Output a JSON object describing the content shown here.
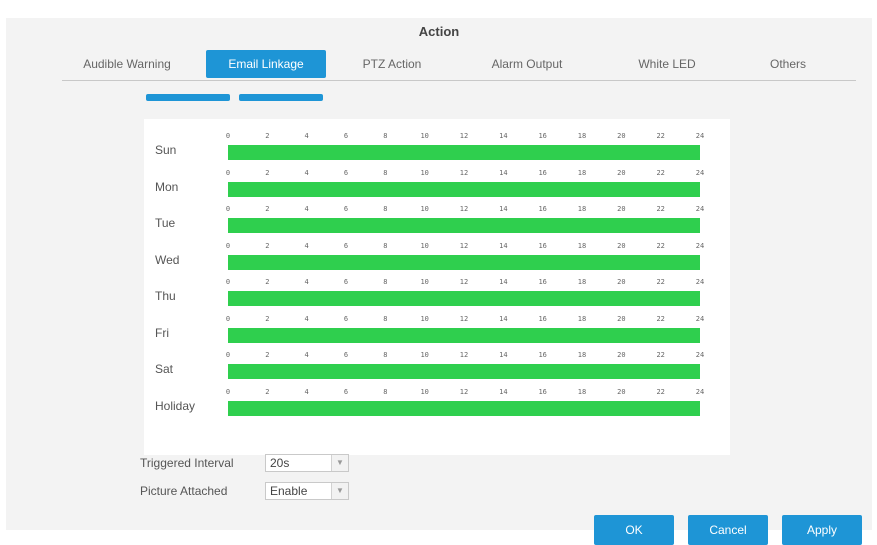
{
  "dialog": {
    "title": "Action"
  },
  "tabs": [
    {
      "label": "Audible Warning"
    },
    {
      "label": "Email Linkage"
    },
    {
      "label": "PTZ Action"
    },
    {
      "label": "Alarm Output"
    },
    {
      "label": "White LED"
    },
    {
      "label": "Others"
    }
  ],
  "schedule": {
    "ticks": [
      "0",
      "2",
      "4",
      "6",
      "8",
      "10",
      "12",
      "14",
      "16",
      "18",
      "20",
      "22",
      "24"
    ],
    "bar_color": "#2fcf4e",
    "days": [
      {
        "label": "Sun",
        "coverage": [
          0,
          24
        ]
      },
      {
        "label": "Mon",
        "coverage": [
          0,
          24
        ]
      },
      {
        "label": "Tue",
        "coverage": [
          0,
          24
        ]
      },
      {
        "label": "Wed",
        "coverage": [
          0,
          24
        ]
      },
      {
        "label": "Thu",
        "coverage": [
          0,
          24
        ]
      },
      {
        "label": "Fri",
        "coverage": [
          0,
          24
        ]
      },
      {
        "label": "Sat",
        "coverage": [
          0,
          24
        ]
      },
      {
        "label": "Holiday",
        "coverage": [
          0,
          24
        ]
      }
    ]
  },
  "settings": {
    "triggered_interval_label": "Triggered Interval",
    "triggered_interval_value": "20s",
    "picture_attached_label": "Picture Attached",
    "picture_attached_value": "Enable"
  },
  "buttons": {
    "ok": "OK",
    "cancel": "Cancel",
    "apply": "Apply"
  },
  "colors": {
    "accent": "#1e95d6",
    "schedule_green": "#2fcf4e"
  }
}
